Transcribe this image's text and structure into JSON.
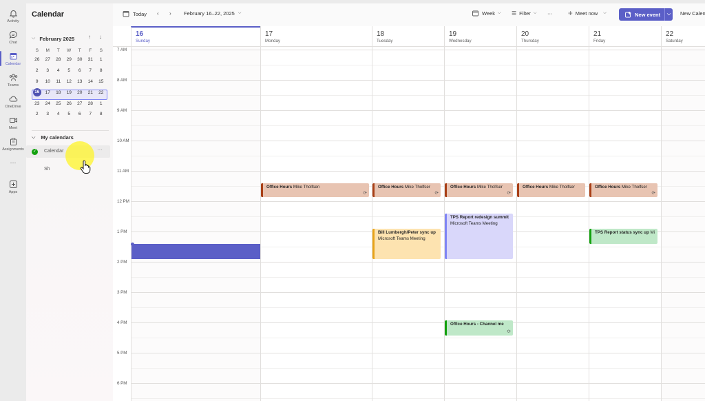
{
  "rail": {
    "items": [
      {
        "label": "Activity",
        "icon": "bell-icon"
      },
      {
        "label": "Chat",
        "icon": "chat-icon"
      },
      {
        "label": "Calendar",
        "icon": "calendar-icon"
      },
      {
        "label": "Teams",
        "icon": "teams-icon"
      },
      {
        "label": "OneDrive",
        "icon": "cloud-icon"
      },
      {
        "label": "Meet",
        "icon": "video-icon"
      },
      {
        "label": "Assignments",
        "icon": "assignments-icon"
      },
      {
        "label": "Apps",
        "icon": "apps-icon"
      }
    ],
    "more": "···"
  },
  "side": {
    "title": "Calendar",
    "month_title": "February 2025",
    "dow": [
      "S",
      "M",
      "T",
      "W",
      "T",
      "F",
      "S"
    ],
    "weeks": [
      [
        "26",
        "27",
        "28",
        "29",
        "30",
        "31",
        "1"
      ],
      [
        "2",
        "3",
        "4",
        "5",
        "6",
        "7",
        "8"
      ],
      [
        "9",
        "10",
        "11",
        "12",
        "13",
        "14",
        "15"
      ],
      [
        "16",
        "17",
        "18",
        "19",
        "20",
        "21",
        "22"
      ],
      [
        "23",
        "24",
        "25",
        "26",
        "27",
        "28",
        "1"
      ],
      [
        "2",
        "3",
        "4",
        "5",
        "6",
        "7",
        "8"
      ]
    ],
    "my_calendars": "My calendars",
    "calendar_name": "Calendar",
    "second_calendar": "Sh",
    "more": "···"
  },
  "toolbar": {
    "today": "Today",
    "range": "February 16–22, 2025",
    "week": "Week",
    "filter": "Filter",
    "more": "···",
    "meet_now": "Meet now",
    "new_event": "New event",
    "new_calendar": "New Calen"
  },
  "days": [
    {
      "num": "16",
      "name": "Sunday"
    },
    {
      "num": "17",
      "name": "Monday"
    },
    {
      "num": "18",
      "name": "Tuesday"
    },
    {
      "num": "19",
      "name": "Wednesday"
    },
    {
      "num": "20",
      "name": "Thursday"
    },
    {
      "num": "21",
      "name": "Friday"
    },
    {
      "num": "22",
      "name": "Saturday"
    }
  ],
  "times": [
    "7 AM",
    "8 AM",
    "9 AM",
    "10 AM",
    "11 AM",
    "12 PM",
    "1 PM",
    "2 PM",
    "3 PM",
    "4 PM",
    "5 PM",
    "6 PM"
  ],
  "events": {
    "oh_title": "Office Hours",
    "oh_mon_person": "Mike Tholfsen",
    "oh_person": "Mike Tholfser",
    "tps_title": "TPS Report redesign summit",
    "tps_sub": "Microsoft Teams Meeting",
    "bill_title": "Bill Lumbergh/Peter sync up",
    "bill_sub": "Microsoft Teams Meeting",
    "tps_status": "TPS Report status sync up",
    "tps_status_extra": "Mi",
    "oh_channel": "Office Hours - Channel me",
    "recurring": "⟳"
  },
  "colors": {
    "accent": "#5b5fc7",
    "office_hours": "#e8c4b2",
    "purple_event": "#d9d7fa",
    "yellow_event": "#fde3b0",
    "green_event": "#bfe8c8"
  }
}
